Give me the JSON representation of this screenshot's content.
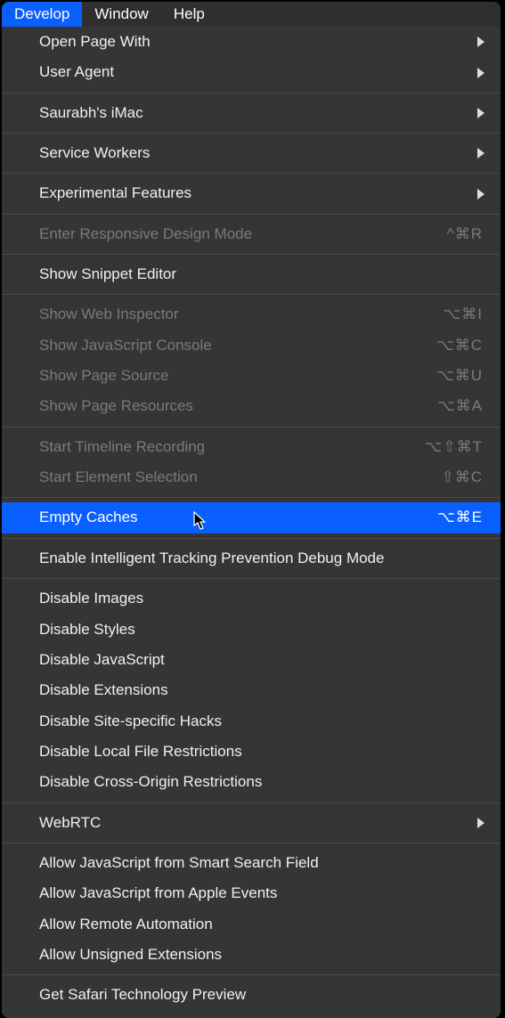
{
  "menubar": {
    "items": [
      {
        "label": "Develop",
        "active": true
      },
      {
        "label": "Window",
        "active": false
      },
      {
        "label": "Help",
        "active": false
      }
    ]
  },
  "menu": {
    "groups": [
      [
        {
          "label": "Open Page With",
          "submenu": true
        },
        {
          "label": "User Agent",
          "submenu": true
        }
      ],
      [
        {
          "label": "Saurabh's iMac",
          "submenu": true
        }
      ],
      [
        {
          "label": "Service Workers",
          "submenu": true
        }
      ],
      [
        {
          "label": "Experimental Features",
          "submenu": true
        }
      ],
      [
        {
          "label": "Enter Responsive Design Mode",
          "disabled": true,
          "shortcut": "^⌘R"
        }
      ],
      [
        {
          "label": "Show Snippet Editor"
        }
      ],
      [
        {
          "label": "Show Web Inspector",
          "disabled": true,
          "shortcut": "⌥⌘I"
        },
        {
          "label": "Show JavaScript Console",
          "disabled": true,
          "shortcut": "⌥⌘C"
        },
        {
          "label": "Show Page Source",
          "disabled": true,
          "shortcut": "⌥⌘U"
        },
        {
          "label": "Show Page Resources",
          "disabled": true,
          "shortcut": "⌥⌘A"
        }
      ],
      [
        {
          "label": "Start Timeline Recording",
          "disabled": true,
          "shortcut": "⌥⇧⌘T"
        },
        {
          "label": "Start Element Selection",
          "disabled": true,
          "shortcut": "⇧⌘C"
        }
      ],
      [
        {
          "label": "Empty Caches",
          "highlighted": true,
          "shortcut": "⌥⌘E",
          "cursor": true
        }
      ],
      [
        {
          "label": "Enable Intelligent Tracking Prevention Debug Mode"
        }
      ],
      [
        {
          "label": "Disable Images"
        },
        {
          "label": "Disable Styles"
        },
        {
          "label": "Disable JavaScript"
        },
        {
          "label": "Disable Extensions"
        },
        {
          "label": "Disable Site-specific Hacks"
        },
        {
          "label": "Disable Local File Restrictions"
        },
        {
          "label": "Disable Cross-Origin Restrictions"
        }
      ],
      [
        {
          "label": "WebRTC",
          "submenu": true
        }
      ],
      [
        {
          "label": "Allow JavaScript from Smart Search Field"
        },
        {
          "label": "Allow JavaScript from Apple Events"
        },
        {
          "label": "Allow Remote Automation"
        },
        {
          "label": "Allow Unsigned Extensions"
        }
      ],
      [
        {
          "label": "Get Safari Technology Preview"
        }
      ]
    ]
  }
}
